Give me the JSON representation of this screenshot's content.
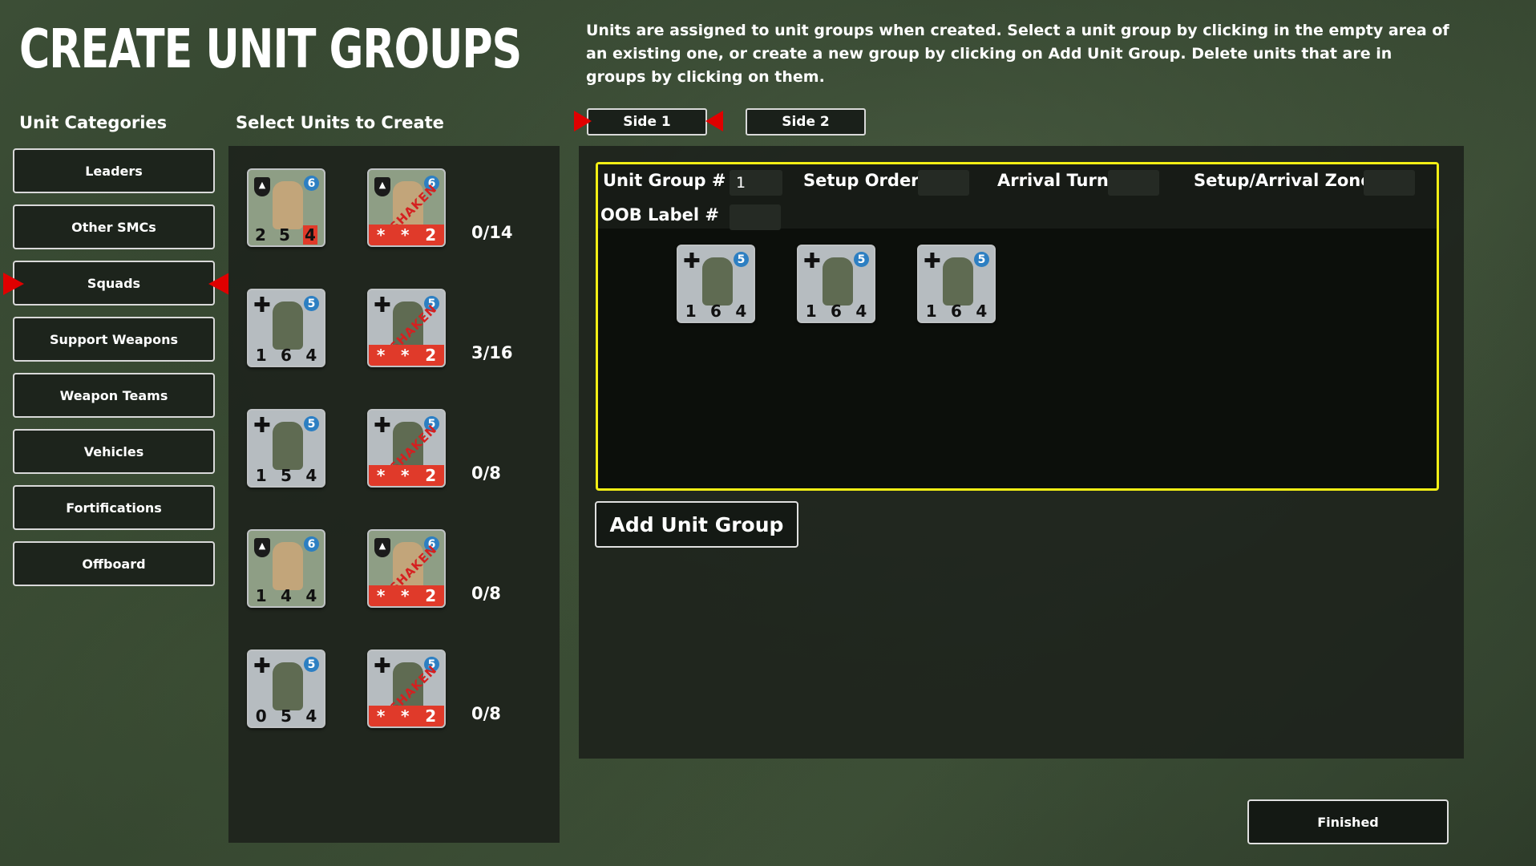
{
  "title": "CREATE UNIT GROUPS",
  "instructions": "Units are assigned to unit groups when created.  Select a unit group by clicking in the empty area of an existing one, or create a new group by clicking on Add Unit Group.  Delete units that are in groups by clicking on them.",
  "categories_label": "Unit Categories",
  "units_label": "Select Units to Create",
  "categories": [
    "Leaders",
    "Other SMCs",
    "Squads",
    "Support Weapons",
    "Weapon Teams",
    "Vehicles",
    "Fortifications",
    "Offboard"
  ],
  "selected_category": "Squads",
  "unit_rows": [
    {
      "count": "0/14",
      "normal": {
        "morale": "6",
        "stats": [
          "2",
          "5",
          "4"
        ]
      },
      "shaken": {
        "morale": "6",
        "stats": [
          "*",
          "*",
          "2"
        ]
      }
    },
    {
      "count": "3/16",
      "normal": {
        "morale": "5",
        "stats": [
          "1",
          "6",
          "4"
        ]
      },
      "shaken": {
        "morale": "5",
        "stats": [
          "*",
          "*",
          "2"
        ]
      }
    },
    {
      "count": "0/8",
      "normal": {
        "morale": "5",
        "stats": [
          "1",
          "5",
          "4"
        ]
      },
      "shaken": {
        "morale": "5",
        "stats": [
          "*",
          "*",
          "2"
        ]
      }
    },
    {
      "count": "0/8",
      "normal": {
        "morale": "6",
        "stats": [
          "1",
          "4",
          "4"
        ]
      },
      "shaken": {
        "morale": "6",
        "stats": [
          "*",
          "*",
          "2"
        ]
      }
    },
    {
      "count": "0/8",
      "normal": {
        "morale": "5",
        "stats": [
          "0",
          "5",
          "4"
        ]
      },
      "shaken": {
        "morale": "5",
        "stats": [
          "*",
          "*",
          "2"
        ]
      }
    }
  ],
  "shaken_text": "SHAKEN",
  "sides": [
    "Side 1",
    "Side 2"
  ],
  "selected_side": "Side 1",
  "group": {
    "unit_group_label": "Unit Group #",
    "unit_group_value": "1",
    "setup_order_label": "Setup Order:",
    "setup_order_value": "",
    "arrival_turn_label": "Arrival Turn:",
    "arrival_turn_value": "",
    "zone_label": "Setup/Arrival Zone:",
    "zone_value": "",
    "oob_label": "OOB Label #",
    "oob_value": "",
    "units": [
      {
        "morale": "5",
        "stats": [
          "1",
          "6",
          "4"
        ]
      },
      {
        "morale": "5",
        "stats": [
          "1",
          "6",
          "4"
        ]
      },
      {
        "morale": "5",
        "stats": [
          "1",
          "6",
          "4"
        ]
      }
    ]
  },
  "add_group_label": "Add Unit Group",
  "finished_label": "Finished",
  "icons": {
    "german": "balkenkreuz-icon",
    "us": "screaming-eagle-icon"
  },
  "colors": {
    "highlight": "#f2ee15",
    "selector": "#e00000",
    "morale_badge": "#2d7fc2",
    "shaken": "#e03a2a"
  }
}
